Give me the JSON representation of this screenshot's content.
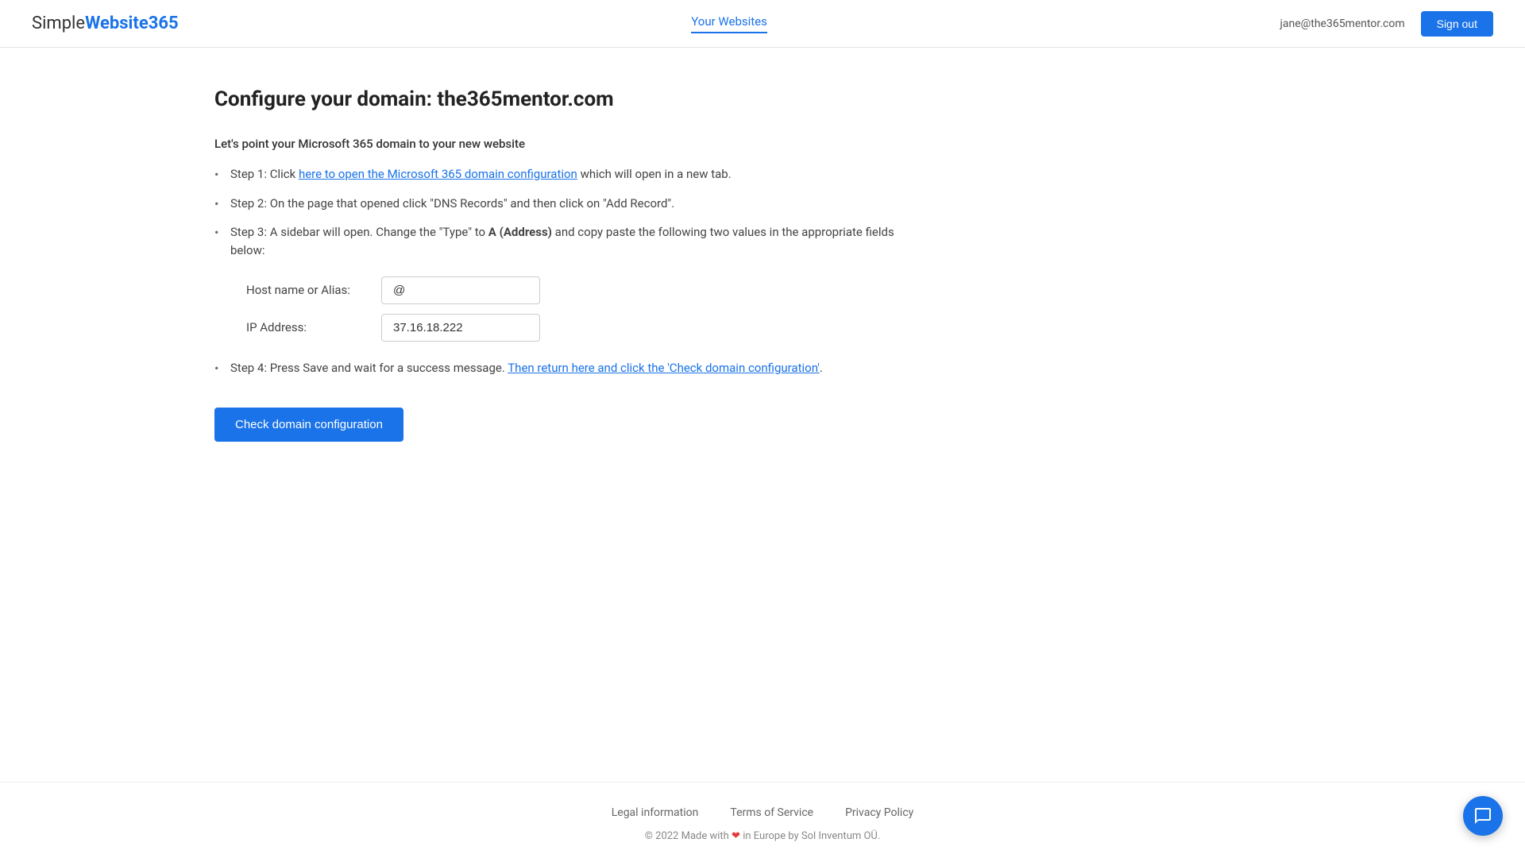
{
  "header": {
    "logo": {
      "simple": "Simple",
      "website365": "Website365"
    },
    "nav": [
      {
        "label": "Your Websites",
        "active": true
      }
    ],
    "user_email": "jane@the365mentor.com",
    "sign_out": "Sign out"
  },
  "main": {
    "page_title": "Configure your domain: the365mentor.com",
    "subtitle": "Let's point your Microsoft 365 domain to your new website",
    "step1_prefix": "Step 1: Click ",
    "step1_link": "here to open the Microsoft 365 domain configuration",
    "step1_suffix": " which will open in a new tab.",
    "step2": "Step 2: On the page that opened click \"DNS Records\" and then click on \"Add Record\".",
    "step3_prefix": "Step 3: A sidebar will open. Change the \"Type\" to ",
    "step3_bold": "A (Address)",
    "step3_suffix": " and copy paste the following two values in the appropriate fields below:",
    "host_label": "Host name or Alias:",
    "host_value": "@",
    "ip_label": "IP Address:",
    "ip_value": "37.16.18.222",
    "step4_prefix": "Step 4: Press Save and wait for a success message. ",
    "step4_link": "Then return here and click the 'Check domain configuration'",
    "step4_suffix": ".",
    "check_btn": "Check domain configuration"
  },
  "footer": {
    "links": [
      {
        "label": "Legal information"
      },
      {
        "label": "Terms of Service"
      },
      {
        "label": "Privacy Policy"
      }
    ],
    "copyright": "© 2022 Made with",
    "copyright_suffix": " in Europe by Sol Inventum OÜ."
  }
}
